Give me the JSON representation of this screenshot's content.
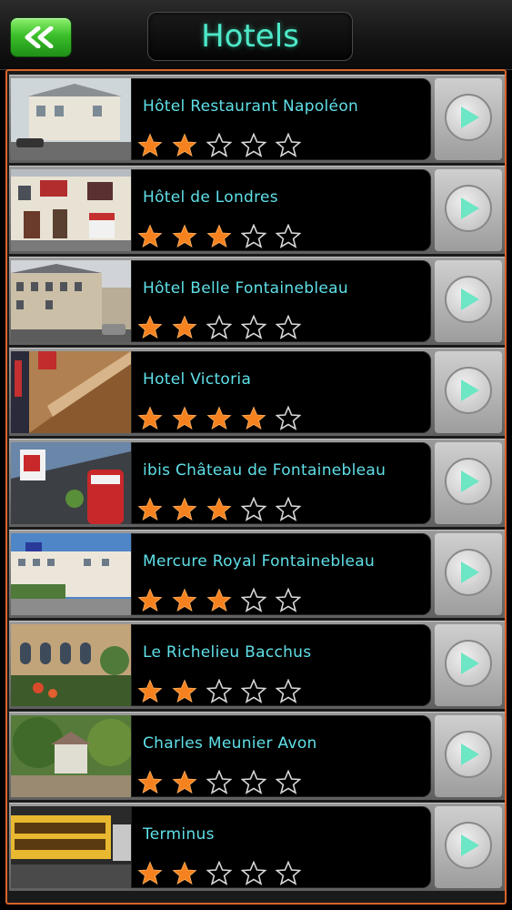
{
  "header": {
    "title": "Hotels",
    "back_icon": "double-chevron-left-icon"
  },
  "colors": {
    "accent_title": "#4ee8c8",
    "hotel_name": "#5fe0e8",
    "star_filled": "#f5821f",
    "frame_border": "#d8642a",
    "back_button": "#3cbf2b"
  },
  "hotels": [
    {
      "name": "Hôtel Restaurant Napoléon",
      "rating": 2,
      "max_rating": 5
    },
    {
      "name": "Hôtel de Londres",
      "rating": 3,
      "max_rating": 5
    },
    {
      "name": "Hôtel Belle Fontainebleau",
      "rating": 2,
      "max_rating": 5
    },
    {
      "name": "Hotel Victoria",
      "rating": 4,
      "max_rating": 5
    },
    {
      "name": "ibis Château de Fontainebleau",
      "rating": 3,
      "max_rating": 5
    },
    {
      "name": "Mercure Royal Fontainebleau",
      "rating": 3,
      "max_rating": 5
    },
    {
      "name": "Le Richelieu Bacchus",
      "rating": 2,
      "max_rating": 5
    },
    {
      "name": "Charles Meunier Avon",
      "rating": 2,
      "max_rating": 5
    },
    {
      "name": "Terminus",
      "rating": 2,
      "max_rating": 5
    }
  ]
}
